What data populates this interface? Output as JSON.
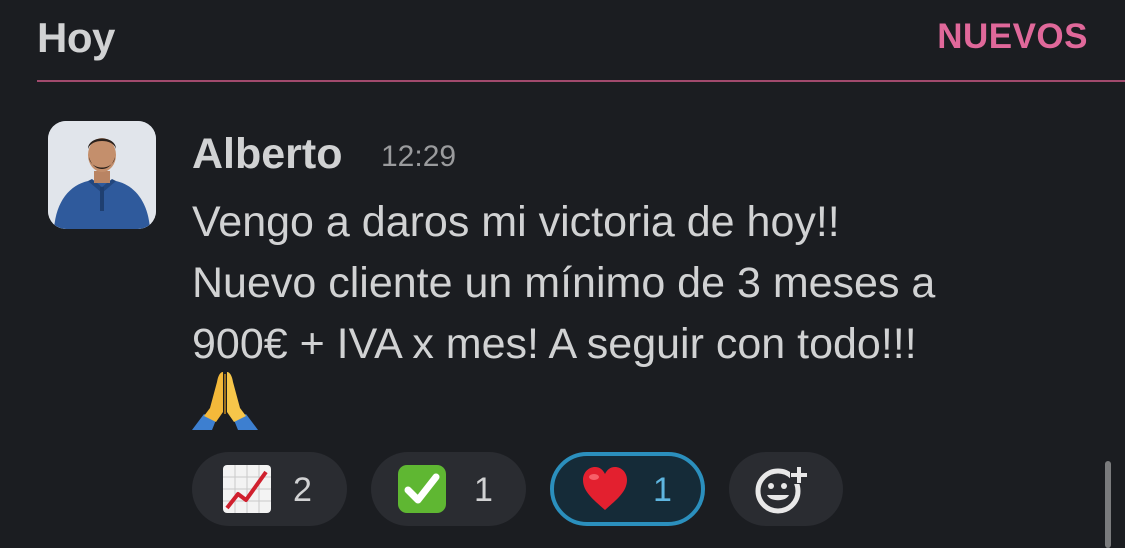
{
  "header": {
    "day": "Hoy",
    "new_marker": "NUEVOS"
  },
  "message": {
    "author": "Alberto",
    "time": "12:29",
    "lines": [
      "Vengo a daros mi victoria de hoy!!",
      "Nuevo cliente un mínimo de 3 meses a",
      "900€ + IVA x mes! A seguir con todo!!!"
    ],
    "trailing_emoji": "folded-hands"
  },
  "reactions": [
    {
      "emoji": "chart-increasing",
      "count": "2",
      "active": false
    },
    {
      "emoji": "white-check-mark",
      "count": "1",
      "active": false
    },
    {
      "emoji": "red-heart",
      "count": "1",
      "active": true
    }
  ],
  "colors": {
    "background": "#1b1d21",
    "new_marker": "#e0689a",
    "active_reaction_border": "#2b8fbd"
  }
}
